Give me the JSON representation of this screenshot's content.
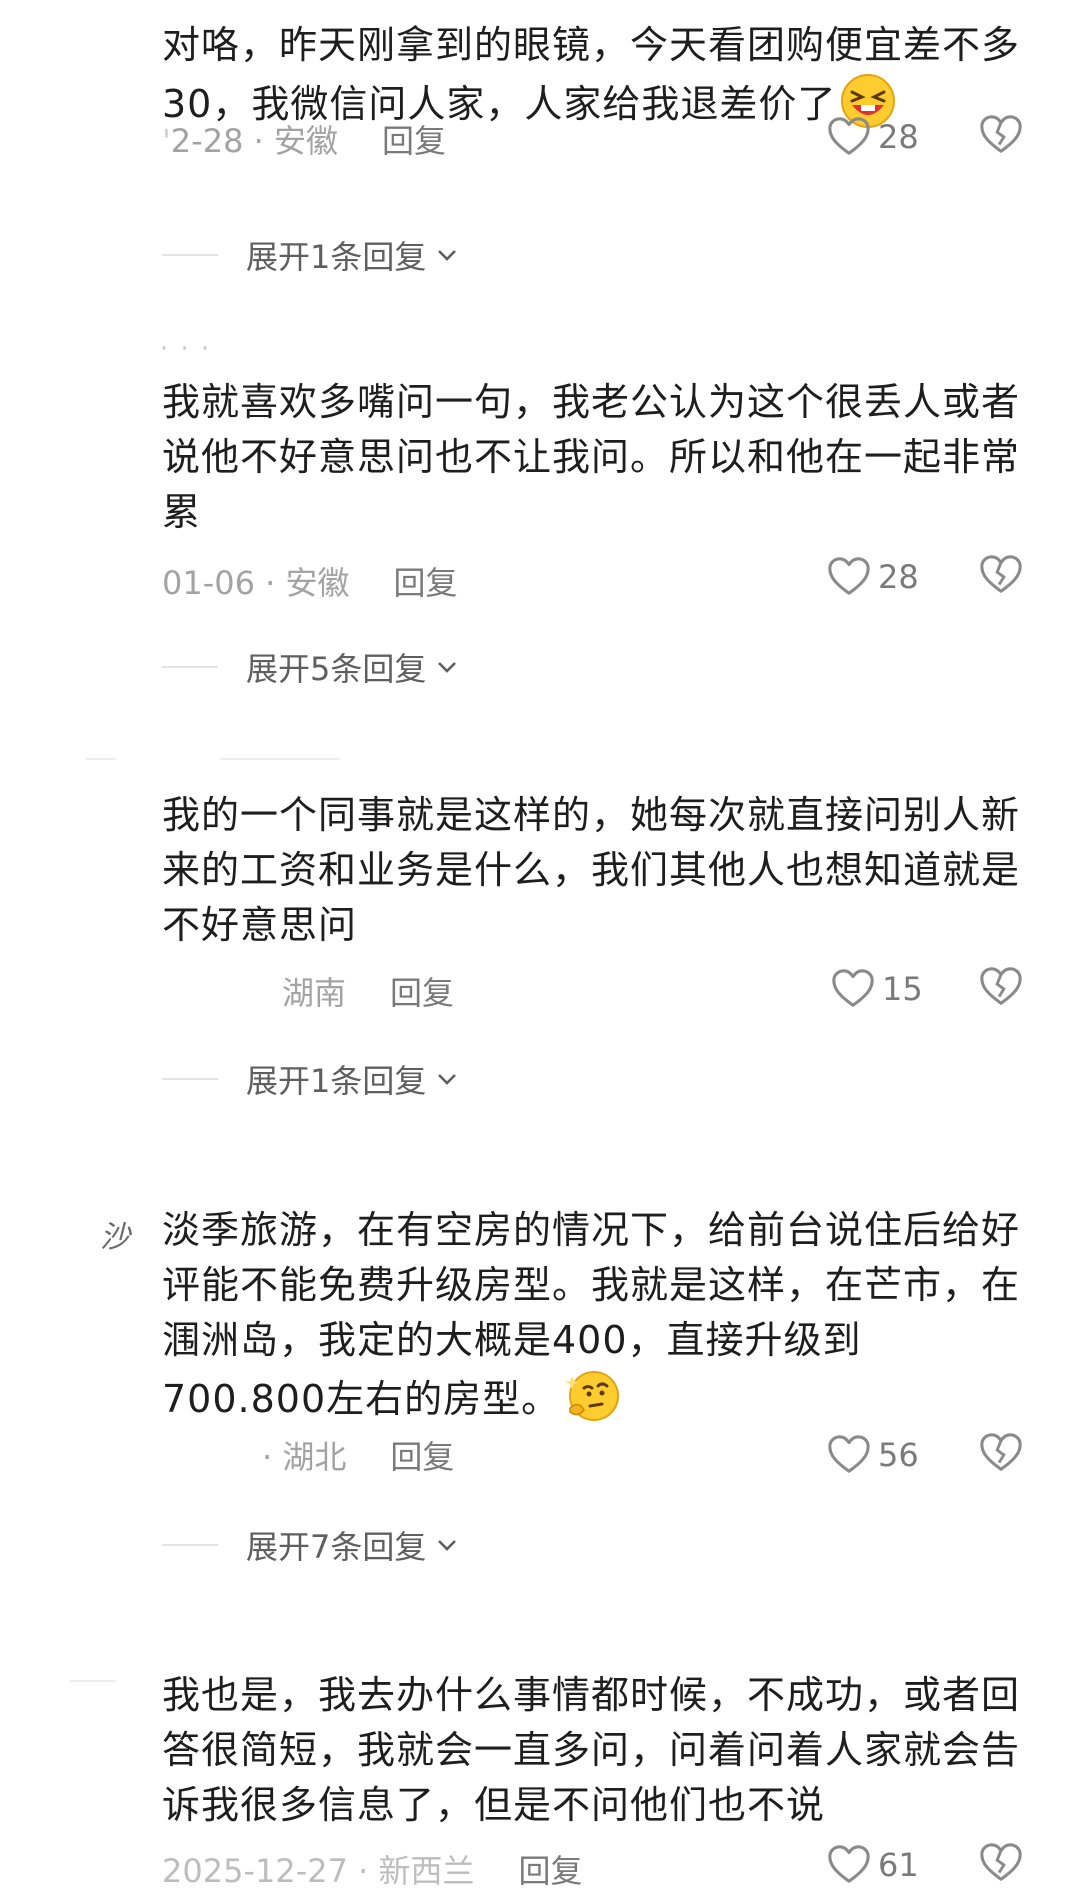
{
  "comments": [
    {
      "text": "对咯，昨天刚拿到的眼镜，今天看团购便宜差不多30，我微信问人家，人家给我退差价了",
      "date": "2-28",
      "location": "安徽",
      "reply_label": "回复",
      "likes": "28",
      "expand_label": "展开1条回复",
      "emoji": "grinning-squint-emoji"
    },
    {
      "text": "我就喜欢多嘴问一句，我老公认为这个很丢人或者说他不好意思问也不让我问。所以和他在一起非常累",
      "date": "01-06",
      "location": "安徽",
      "reply_label": "回复",
      "likes": "28",
      "expand_label": "展开5条回复"
    },
    {
      "text": "我的一个同事就是这样的，她每次就直接问别人新来的工资和业务是什么，我们其他人也想知道就是不好意思问",
      "date": "",
      "location": "湖南",
      "reply_label": "回复",
      "likes": "15",
      "expand_label": "展开1条回复"
    },
    {
      "avatar_text": "沙",
      "text": "淡季旅游，在有空房的情况下，给前台说住后给好评能不能免费升级房型。我就是这样，在芒市，在涠洲岛，我定的大概是400，直接升级到700.800左右的房型。",
      "date": "",
      "location": "湖北",
      "reply_label": "回复",
      "likes": "56",
      "expand_label": "展开7条回复",
      "emoji": "thinking-emoji"
    },
    {
      "text": "我也是，我去办什么事情都时候，不成功，或者回答很简短，我就会一直多问，问着问着人家就会告诉我很多信息了，但是不问他们也不说",
      "date": "2025-12-27",
      "location": "新西兰",
      "reply_label": "回复",
      "likes": "61"
    }
  ],
  "colors": {
    "text": "#1e1e1e",
    "meta": "#a3a3a3",
    "icon": "#7a7a7a"
  },
  "icons": {
    "like": "heart-outline-icon",
    "dislike": "broken-heart-icon",
    "expand": "chevron-down-icon"
  }
}
